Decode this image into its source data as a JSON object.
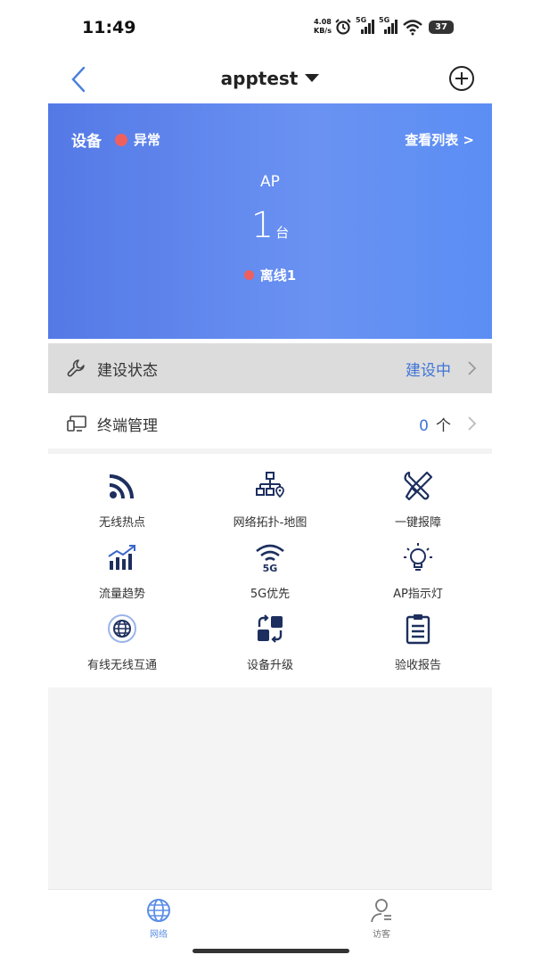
{
  "status_bar": {
    "time": "11:49",
    "net_speed_value": "4.08",
    "net_speed_unit": "KB/s",
    "signal_1": "5G",
    "signal_2": "5G",
    "battery": "37"
  },
  "navbar": {
    "title": "apptest"
  },
  "device_card": {
    "title": "设备",
    "status": "异常",
    "status_color": "#ee6060",
    "view_list": "查看列表 >",
    "type": "AP",
    "count": "1",
    "count_unit": "台",
    "offline": "离线1"
  },
  "rows": {
    "build": {
      "label": "建设状态",
      "value": "建设中"
    },
    "terminal": {
      "label": "终端管理",
      "value": "0",
      "unit": "个"
    }
  },
  "features": [
    {
      "label": "无线热点",
      "icon": "wifi-signal-icon"
    },
    {
      "label": "网络拓扑-地图",
      "icon": "topology-icon"
    },
    {
      "label": "一键报障",
      "icon": "tools-icon"
    },
    {
      "label": "流量趋势",
      "icon": "trend-icon"
    },
    {
      "label": "5G优先",
      "icon": "wifi-5g-icon"
    },
    {
      "label": "AP指示灯",
      "icon": "lightbulb-icon"
    },
    {
      "label": "有线无线互通",
      "icon": "globe-icon"
    },
    {
      "label": "设备升级",
      "icon": "upgrade-icon"
    },
    {
      "label": "验收报告",
      "icon": "clipboard-icon"
    }
  ],
  "tabbar": {
    "network": "网络",
    "visitor": "访客"
  },
  "colors": {
    "accent": "#3f74d6",
    "icon_navy": "#1d2f5e",
    "card_gradient_start": "#5479e6",
    "card_gradient_end": "#5b8ef4"
  }
}
